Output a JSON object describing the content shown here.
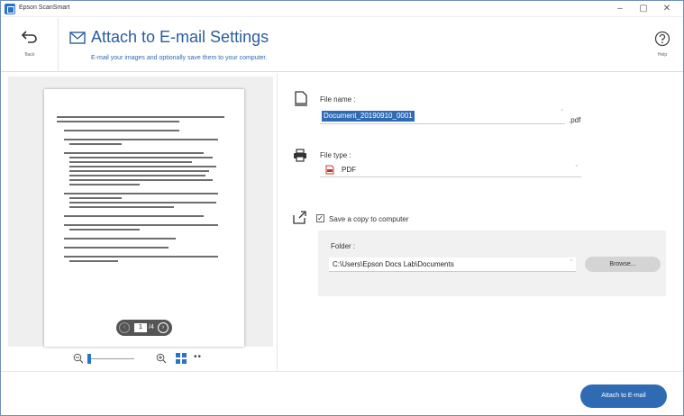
{
  "app": {
    "title": "Epson ScanSmart"
  },
  "window_controls": {
    "minimize": "–",
    "maximize": "▢",
    "close": "✕"
  },
  "header": {
    "back_label": "Back",
    "title": "Attach to E-mail Settings",
    "subtitle": "E-mail your images and optionally save them to your computer.",
    "help_label": "Help"
  },
  "preview": {
    "page_current": "1",
    "page_total": "/4"
  },
  "file_name": {
    "label": "File name :",
    "value": "Document_20190910_0001",
    "extension": ".pdf"
  },
  "file_type": {
    "label": "File type :",
    "value": "PDF"
  },
  "save_copy": {
    "label": "Save a copy to computer",
    "checked": true,
    "folder_label": "Folder :",
    "folder_value": "C:\\Users\\Epson Docs Lab\\Documents",
    "browse_label": "Browse..."
  },
  "footer": {
    "attach_label": "Attach to E-mail"
  },
  "colors": {
    "accent": "#2f6bb3",
    "title": "#2a5d9f"
  }
}
